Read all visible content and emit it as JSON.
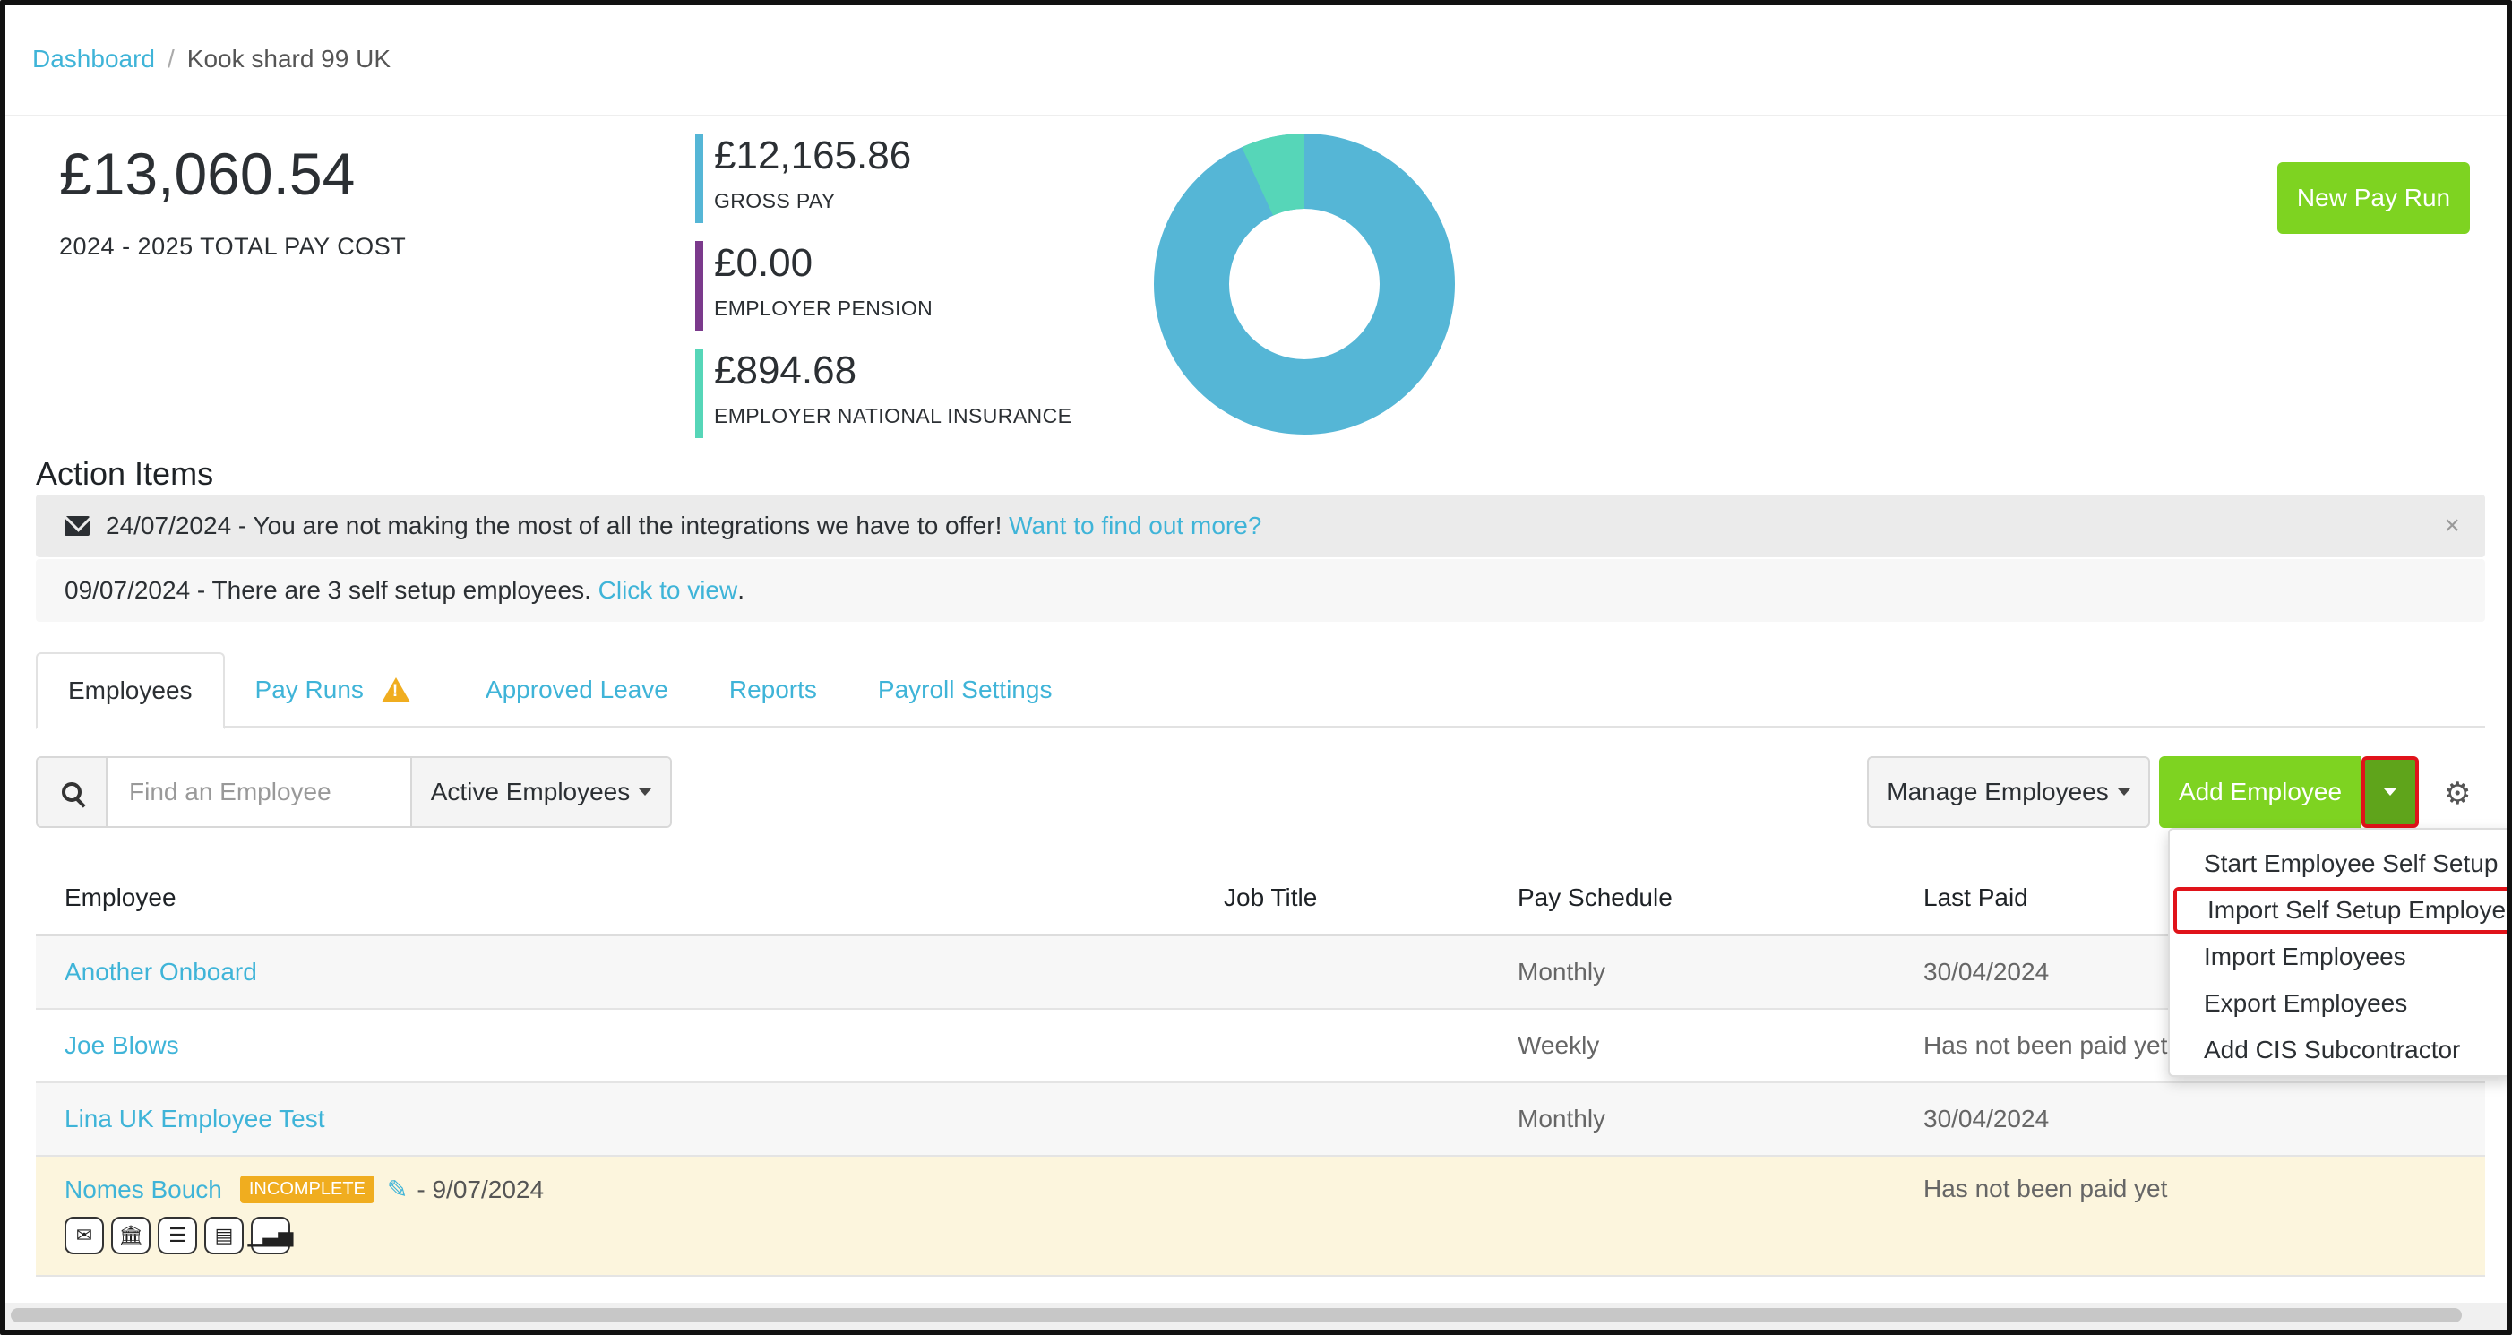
{
  "breadcrumb": {
    "root": "Dashboard",
    "separator": "/",
    "current": "Kook shard 99 UK"
  },
  "summary": {
    "total_amount": "£13,060.54",
    "total_label": "2024 - 2025 TOTAL PAY COST",
    "stats": [
      {
        "amount": "£12,165.86",
        "label": "GROSS PAY",
        "color": "#55b6d6"
      },
      {
        "amount": "£0.00",
        "label": "EMPLOYER PENSION",
        "color": "#7b3a8c"
      },
      {
        "amount": "£894.68",
        "label": "EMPLOYER NATIONAL INSURANCE",
        "color": "#56d6b8"
      }
    ],
    "new_pay_run_label": "New Pay Run"
  },
  "colors": {
    "accent_green": "#7ed321",
    "link": "#3fb4d8",
    "warning": "#f0ad1f",
    "highlight_red": "#e0131a"
  },
  "action_items": {
    "title": "Action Items",
    "items": [
      {
        "text": "24/07/2024 - You are not making the most of all the integrations we have to offer! ",
        "link": "Want to find out more?",
        "suffix": "",
        "close": "×"
      },
      {
        "text": "09/07/2024 - There are 3 self setup employees. ",
        "link": "Click to view",
        "suffix": "."
      }
    ]
  },
  "tabs": [
    "Employees",
    "Pay Runs",
    "Approved Leave",
    "Reports",
    "Payroll Settings"
  ],
  "toolbar": {
    "search_placeholder": "Find an Employee",
    "filter_label": "Active Employees",
    "manage_label": "Manage Employees",
    "add_label": "Add Employee"
  },
  "add_menu": [
    "Start Employee Self Setup",
    "Import Self Setup Employees",
    "Import Employees",
    "Export Employees",
    "Add CIS Subcontractor"
  ],
  "table": {
    "headers": [
      "Employee",
      "Job Title",
      "Pay Schedule",
      "Last Paid"
    ],
    "rows": [
      {
        "name": "Another Onboard",
        "job": "",
        "schedule": "Monthly",
        "last_paid": "30/04/2024"
      },
      {
        "name": "Joe Blows",
        "job": "",
        "schedule": "Weekly",
        "last_paid": "Has not been paid yet"
      },
      {
        "name": "Lina UK Employee Test",
        "job": "",
        "schedule": "Monthly",
        "last_paid": "30/04/2024"
      },
      {
        "name": "Nomes Bouch",
        "badge": "INCOMPLETE",
        "date": "- 9/07/2024",
        "job": "",
        "schedule": "",
        "last_paid": "Has not been paid yet"
      }
    ]
  }
}
